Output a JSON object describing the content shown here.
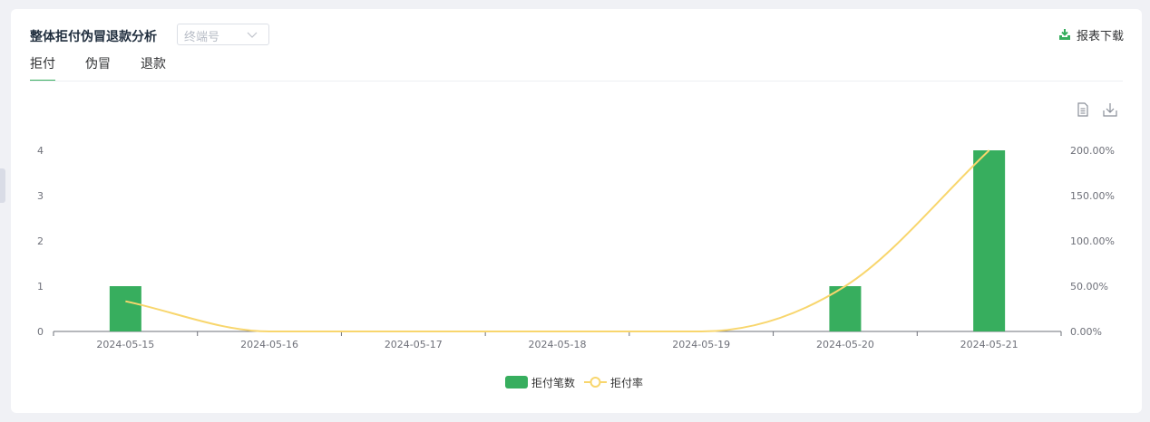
{
  "header": {
    "title": "整体拒付伪冒退款分析",
    "terminal_placeholder": "终端号",
    "download_label": "报表下载"
  },
  "tabs": [
    {
      "label": "拒付",
      "active": true
    },
    {
      "label": "伪冒",
      "active": false
    },
    {
      "label": "退款",
      "active": false
    }
  ],
  "toolbox": {
    "data_view_icon": "document-icon",
    "save_icon": "download-icon"
  },
  "colors": {
    "bar": "#37ae5e",
    "line": "#f8d66d",
    "accent": "#37ae5e"
  },
  "chart_data": {
    "type": "bar",
    "categories": [
      "2024-05-15",
      "2024-05-16",
      "2024-05-17",
      "2024-05-18",
      "2024-05-19",
      "2024-05-20",
      "2024-05-21"
    ],
    "series": [
      {
        "name": "拒付笔数",
        "type": "bar",
        "axis": "left",
        "values": [
          1,
          0,
          0,
          0,
          0,
          1,
          4
        ]
      },
      {
        "name": "拒付率",
        "type": "line",
        "axis": "right",
        "smooth": true,
        "values": [
          33.33,
          0,
          0,
          0,
          0,
          50,
          200
        ]
      }
    ],
    "y_left": {
      "min": 0,
      "max": 4,
      "ticks": [
        "0",
        "1",
        "2",
        "3",
        "4"
      ]
    },
    "y_right": {
      "min": 0,
      "max": 200,
      "ticks": [
        "0.00%",
        "50.00%",
        "100.00%",
        "150.00%",
        "200.00%"
      ]
    },
    "grid": false,
    "legend_position": "bottom-center"
  }
}
